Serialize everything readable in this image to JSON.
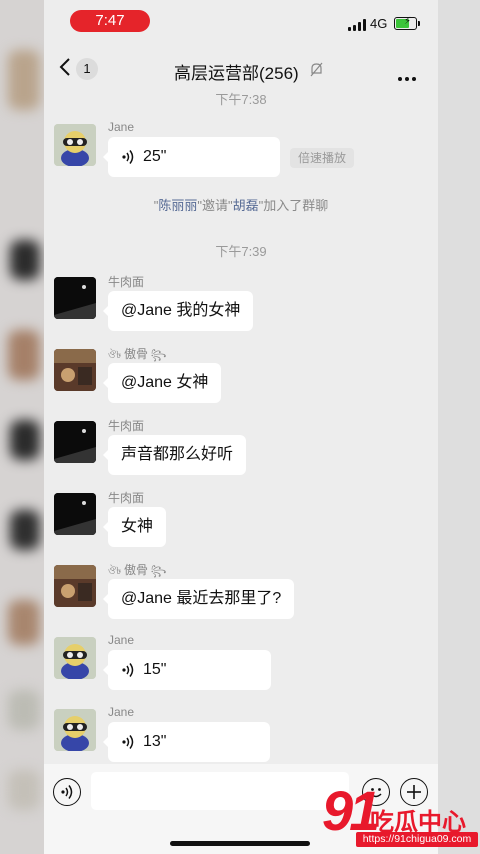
{
  "status_bar": {
    "time": "7:47",
    "network": "4G"
  },
  "header": {
    "unread_count": "1",
    "title": "高层运营部(256)"
  },
  "messages": [
    {
      "sender": "Jane",
      "duration": "25\"",
      "speed_label": "倍速播放"
    },
    {
      "sender": "牛肉面",
      "text": "@Jane 我的女神"
    },
    {
      "sender": "傲骨",
      "text": "@Jane 女神"
    },
    {
      "sender": "牛肉面",
      "text": "声音都那么好听"
    },
    {
      "sender": "牛肉面",
      "text": "女神"
    },
    {
      "sender": "傲骨",
      "text": "@Jane 最近去那里了?"
    },
    {
      "sender": "Jane",
      "duration": "15\""
    },
    {
      "sender": "Jane",
      "duration": "13\""
    }
  ],
  "timestamps": [
    "下午7:38",
    "下午7:39"
  ],
  "system_message": {
    "quote_open": "\"",
    "inviter": "陈丽丽",
    "middle": "\"邀请\"",
    "invitee": "胡磊",
    "tail": "\"加入了群聊"
  },
  "watermark": {
    "number": "91",
    "name": "吃瓜中心",
    "url": "https://91chigua09.com"
  },
  "colors": {
    "accent_link": "#576b95",
    "time_pill": "#e5242a",
    "battery": "#3cc43a",
    "watermark": "#e8192c"
  }
}
